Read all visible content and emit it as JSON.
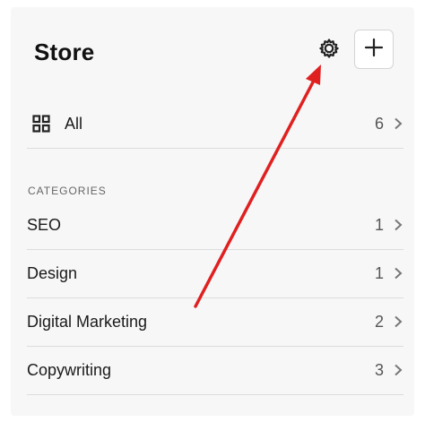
{
  "header": {
    "title": "Store"
  },
  "all_row": {
    "label": "All",
    "count": "6"
  },
  "categories": {
    "heading": "CATEGORIES",
    "items": [
      {
        "label": "SEO",
        "count": "1"
      },
      {
        "label": "Design",
        "count": "1"
      },
      {
        "label": "Digital Marketing",
        "count": "2"
      },
      {
        "label": "Copywriting",
        "count": "3"
      }
    ]
  },
  "icons": {
    "settings": "gear-icon",
    "add": "plus-icon",
    "all": "grid-icon",
    "row_arrow": "chevron-right-icon"
  },
  "colors": {
    "annotation_arrow": "#e02020",
    "panel_bg": "#f7f7f7",
    "divider": "#dcdcdc"
  }
}
